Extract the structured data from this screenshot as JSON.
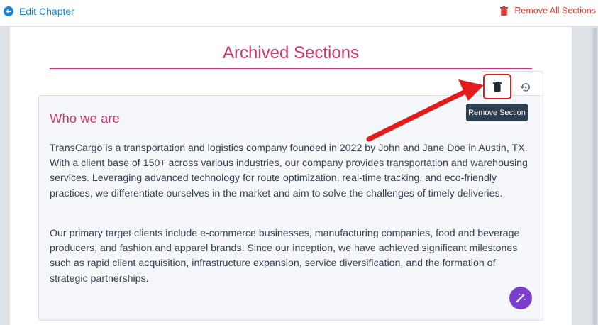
{
  "header": {
    "back_label": "Edit Chapter",
    "remove_all_label": "Remove All Sections"
  },
  "main": {
    "title": "Archived Sections",
    "section": {
      "heading": "Who we are",
      "paragraphs": [
        "TransCargo is a transportation and logistics company founded in 2022 by John and Jane Doe in Austin, TX. With a client base of 150+ across various industries, our company provides transportation and warehousing services. Leveraging advanced technology for route optimization, real-time tracking, and eco-friendly practices, we differentiate ourselves in the market and aim to solve the challenges of timely deliveries.",
        "Our primary target clients include e-commerce businesses, manufacturing companies, food and beverage producers, and fashion and apparel brands. Since our inception, we have achieved significant milestones such as rapid client acquisition, infrastructure expansion, service diversification, and the formation of strategic partnerships."
      ]
    },
    "tooltip": "Remove Section"
  },
  "icons": {
    "back": "arrow-circle-left-icon",
    "trash": "trash-icon",
    "restore": "restore-icon",
    "magic": "magic-wand-icon"
  },
  "colors": {
    "accent_blue": "#1a85d6",
    "danger_red": "#e53935",
    "title_pink": "#d6336c",
    "magic_purple": "#7b3fd0",
    "tooltip_bg": "#2c3e50",
    "annotation_red": "#e21b1b"
  }
}
